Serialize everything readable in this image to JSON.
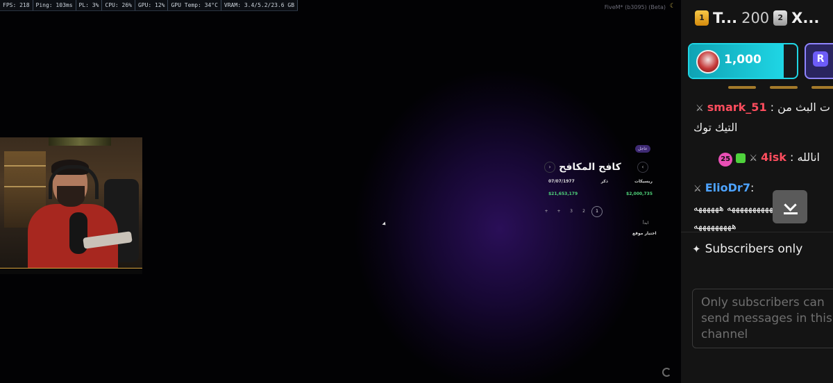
{
  "perf_bar": [
    "FPS: 218",
    "Ping: 103ms",
    "PL: 3%",
    "CPU: 26%",
    "GPU: 12%",
    "GPU Temp: 34°C",
    "VRAM: 3.4/5.2/23.6 GB"
  ],
  "game": {
    "version_text": "FiveM* (b3095) (Beta)",
    "phone": {
      "tag": "عاجل",
      "title": "كافح المكافح",
      "headers": [
        "07/07/1977",
        "ذكر",
        "ريسيكات"
      ],
      "values": [
        "$21,653,179",
        "$2,000,735"
      ],
      "pages": [
        "1",
        "2",
        "3",
        "+",
        "+"
      ],
      "label_1": "ابدأ",
      "label_2": "اختيار موقع"
    }
  },
  "chat": {
    "header": {
      "rank_1": "1",
      "name_1": "T...",
      "score": "200",
      "rank_2": "2",
      "name_2": "X..."
    },
    "gift": {
      "amount": "1,000",
      "progress": 0.88
    },
    "next_icon": "R",
    "messages": [
      {
        "user": "smark_51",
        "user_color": "#ff4d5e",
        "text": "ت البث من :",
        "text_line2": "التيك توك"
      },
      {
        "badge": "25",
        "user": "4isk",
        "user_color": "#ff4d5e",
        "text": "انالله :"
      },
      {
        "user": "ElioDr7",
        "user_color": "#4da3ff",
        "text": ":",
        "body_line1": "هههههههههههههههه ههههههه",
        "body_line2": "هههههههههه"
      }
    ],
    "subscribers_label": "Subscribers only",
    "input_placeholder": "Only subscribers can send messages in this channel"
  }
}
